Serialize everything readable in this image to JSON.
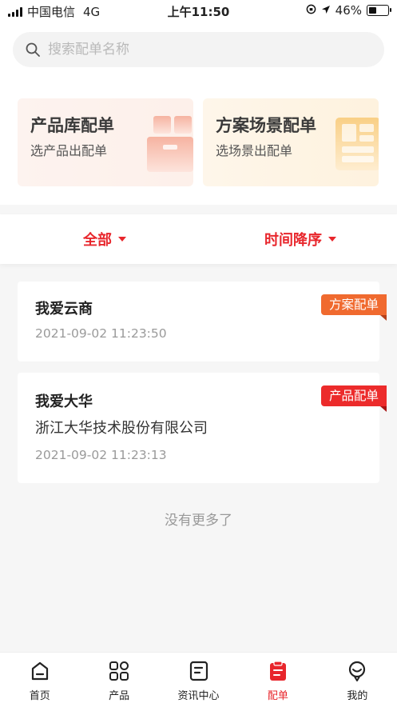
{
  "status_bar": {
    "carrier": "中国电信",
    "network": "4G",
    "time": "上午11:50",
    "battery": "46%",
    "battery_level": 0.46
  },
  "search": {
    "placeholder": "搜索配单名称"
  },
  "cards": [
    {
      "title": "产品库配单",
      "subtitle": "选产品出配单",
      "icon": "package-box-icon"
    },
    {
      "title": "方案场景配单",
      "subtitle": "选场景出配单",
      "icon": "scene-grid-icon"
    }
  ],
  "filters": {
    "all_label": "全部",
    "sort_label": "时间降序"
  },
  "orders": [
    {
      "name": "我爱云商",
      "company": "",
      "date": "2021-09-02 11:23:50",
      "tag": "方案配单",
      "tag_color": "#f06a2f"
    },
    {
      "name": "我爱大华",
      "company": "浙江大华技术股份有限公司",
      "date": "2021-09-02 11:23:13",
      "tag": "产品配单",
      "tag_color": "#ec2b2b"
    }
  ],
  "no_more_text": "没有更多了",
  "tabbar": [
    {
      "label": "首页",
      "icon": "home-icon"
    },
    {
      "label": "产品",
      "icon": "grid-icon"
    },
    {
      "label": "资讯中心",
      "icon": "document-icon"
    },
    {
      "label": "配单",
      "icon": "clipboard-icon",
      "active": true
    },
    {
      "label": "我的",
      "icon": "user-icon"
    }
  ],
  "colors": {
    "accent": "#e8262c"
  }
}
